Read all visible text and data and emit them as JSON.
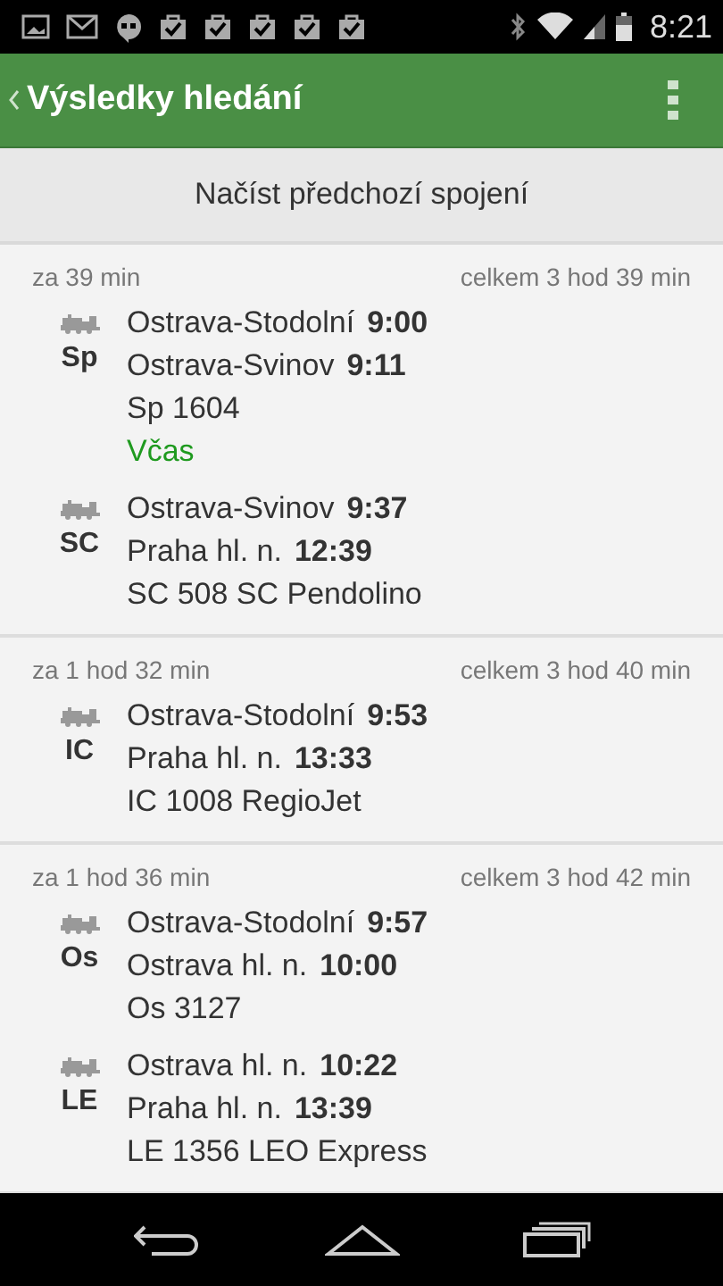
{
  "status_bar": {
    "time": "8:21"
  },
  "app_bar": {
    "title": "Výsledky hledání"
  },
  "load_previous": {
    "label": "Načíst předchozí spojení"
  },
  "connections": [
    {
      "departs_in": "za 39 min",
      "total": "celkem 3 hod 39 min",
      "legs": [
        {
          "type": "Sp",
          "stops": [
            {
              "station": "Ostrava-Stodolní",
              "time": "9:00"
            },
            {
              "station": "Ostrava-Svinov",
              "time": "9:11"
            }
          ],
          "train": "Sp 1604",
          "status": "Včas"
        },
        {
          "type": "SC",
          "stops": [
            {
              "station": "Ostrava-Svinov",
              "time": "9:37"
            },
            {
              "station": "Praha hl. n.",
              "time": "12:39"
            }
          ],
          "train": "SC 508 SC Pendolino"
        }
      ]
    },
    {
      "departs_in": "za 1 hod 32 min",
      "total": "celkem 3 hod 40 min",
      "legs": [
        {
          "type": "IC",
          "stops": [
            {
              "station": "Ostrava-Stodolní",
              "time": "9:53"
            },
            {
              "station": "Praha hl. n.",
              "time": "13:33"
            }
          ],
          "train": "IC 1008 RegioJet"
        }
      ]
    },
    {
      "departs_in": "za 1 hod 36 min",
      "total": "celkem 3 hod 42 min",
      "legs": [
        {
          "type": "Os",
          "stops": [
            {
              "station": "Ostrava-Stodolní",
              "time": "9:57"
            },
            {
              "station": "Ostrava hl. n.",
              "time": "10:00"
            }
          ],
          "train": "Os 3127"
        },
        {
          "type": "LE",
          "stops": [
            {
              "station": "Ostrava hl. n.",
              "time": "10:22"
            },
            {
              "station": "Praha hl. n.",
              "time": "13:39"
            }
          ],
          "train": "LE 1356 LEO Express"
        }
      ]
    }
  ]
}
